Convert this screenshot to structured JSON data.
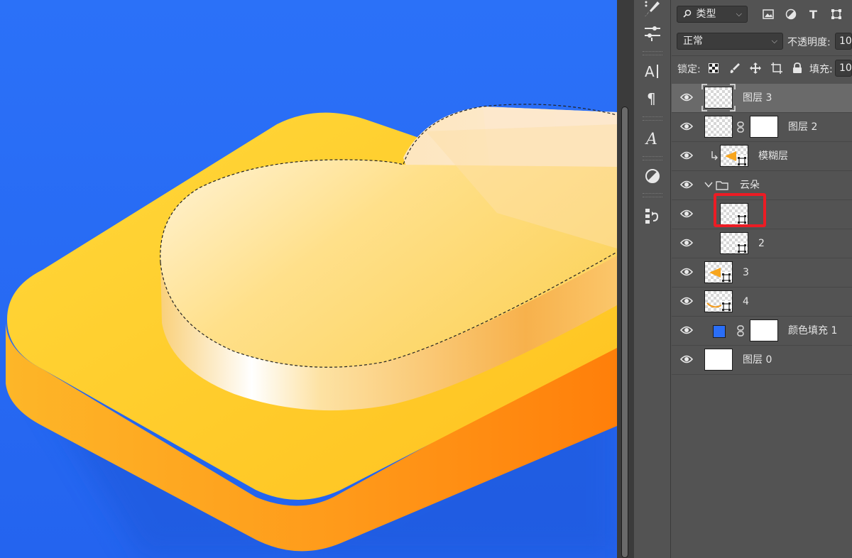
{
  "layers_panel": {
    "filter": {
      "kind_label": "类型",
      "kind_icon": "search-icon",
      "icons": [
        "image-filter-icon",
        "adjustment-filter-icon",
        "type-filter-icon",
        "shape-filter-icon"
      ]
    },
    "blend_mode": "正常",
    "opacity_label": "不透明度:",
    "opacity_value": "10",
    "lock_label": "锁定:",
    "fill_label": "填充:",
    "fill_value": "10",
    "layers": [
      {
        "name": "图层 3",
        "selected": true
      },
      {
        "name": "图层 2"
      },
      {
        "name": "模糊层"
      },
      {
        "name": "云朵",
        "type": "group"
      },
      {
        "name": ""
      },
      {
        "name": "2"
      },
      {
        "name": "3"
      },
      {
        "name": "4"
      },
      {
        "name": "颜色填充 1",
        "swatch_color": "#2a6ef7"
      },
      {
        "name": "图层 0"
      }
    ]
  },
  "colors": {
    "canvas_background": "#2a6ef7",
    "highlight": "#ec1c24",
    "panel": "#535353"
  }
}
